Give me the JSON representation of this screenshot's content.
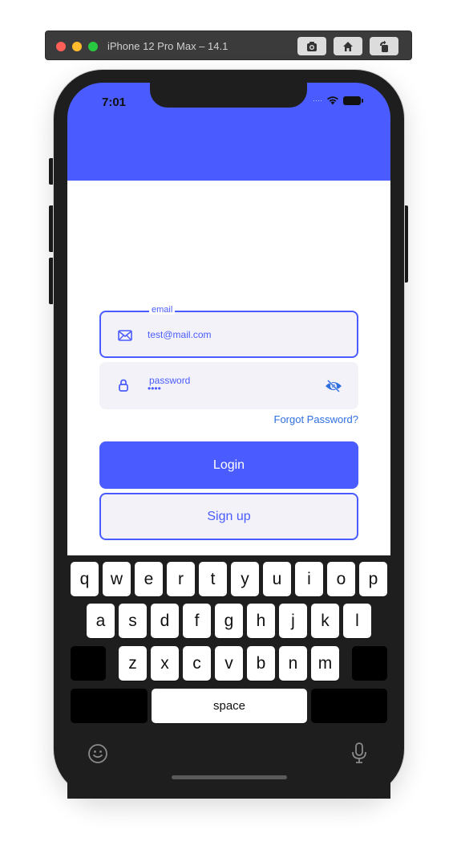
{
  "simulator": {
    "title": "iPhone 12 Pro Max – 14.1",
    "buttons": [
      "screenshot-icon",
      "home-icon",
      "rotate-icon"
    ]
  },
  "status_bar": {
    "time": "7:01"
  },
  "colors": {
    "primary": "#4a5cff",
    "field_bg": "#f2f2f8",
    "link": "#2f6fe0"
  },
  "form": {
    "email": {
      "legend": "email",
      "value": "test@mail.com",
      "icon": "envelope-icon"
    },
    "password": {
      "label": "password",
      "value": "••••",
      "icon": "lock-icon",
      "toggle_icon": "eye-icon"
    },
    "forgot_password": "Forgot Password?",
    "login_label": "Login",
    "signup_label": "Sign up"
  },
  "keyboard": {
    "row1": [
      "q",
      "w",
      "e",
      "r",
      "t",
      "y",
      "u",
      "i",
      "o",
      "p"
    ],
    "row2": [
      "a",
      "s",
      "d",
      "f",
      "g",
      "h",
      "j",
      "k",
      "l"
    ],
    "row3": [
      "z",
      "x",
      "c",
      "v",
      "b",
      "n",
      "m"
    ],
    "space_label": "space"
  }
}
